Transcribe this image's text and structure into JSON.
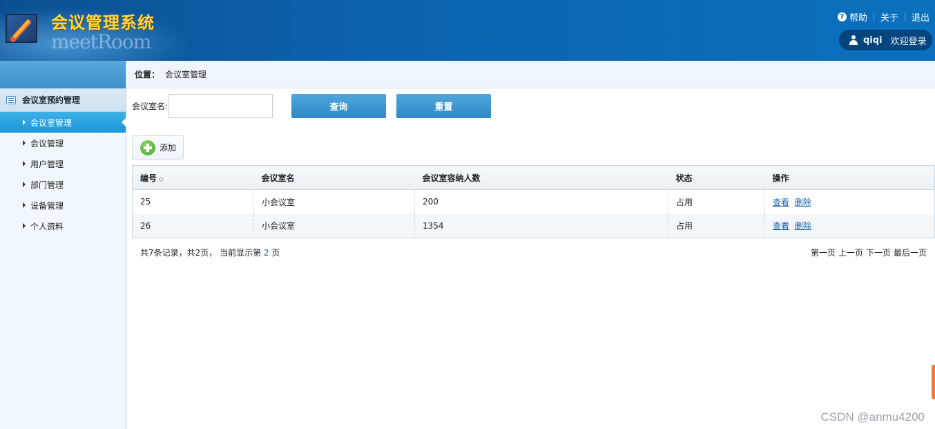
{
  "header": {
    "title": "会议管理系统",
    "subtitle": "meetRoom",
    "links": [
      "帮助",
      "关于",
      "退出"
    ],
    "user_name": "qiqi",
    "welcome": "欢迎登录"
  },
  "sidebar": {
    "group_title": "会议室预约管理",
    "items": [
      {
        "label": "会议室管理",
        "active": true
      },
      {
        "label": "会议管理",
        "active": false
      },
      {
        "label": "用户管理",
        "active": false
      },
      {
        "label": "部门管理",
        "active": false
      },
      {
        "label": "设备管理",
        "active": false
      },
      {
        "label": "个人资料",
        "active": false
      }
    ]
  },
  "breadcrumb": {
    "label": "位置：",
    "current": "会议室管理"
  },
  "search": {
    "label": "会议室名:",
    "value": "",
    "query_button": "查询",
    "reset_button": "重置"
  },
  "toolbar": {
    "add_label": "添加"
  },
  "table": {
    "columns": [
      "编号",
      "会议室名",
      "会议室容纳人数",
      "状态",
      "操作"
    ],
    "rows": [
      {
        "id": "25",
        "name": "小会议室",
        "capacity": "200",
        "status": "占用",
        "view": "查看",
        "delete": "删除"
      },
      {
        "id": "26",
        "name": "小会议室",
        "capacity": "1354",
        "status": "占用",
        "view": "查看",
        "delete": "删除"
      }
    ]
  },
  "pager": {
    "summary_prefix": "共7条记录，共2页， 当前显示第",
    "current_page": "2",
    "summary_suffix": "页",
    "first": "第一页",
    "prev": "上一页",
    "next": "下一页",
    "last": "最后一页"
  },
  "watermark": "CSDN @anmu4200",
  "colors": {
    "header_blue": "#0d63ad",
    "active_blue": "#1d97d8",
    "link_blue": "#1d63a8",
    "title_yellow": "#ffd83a"
  }
}
